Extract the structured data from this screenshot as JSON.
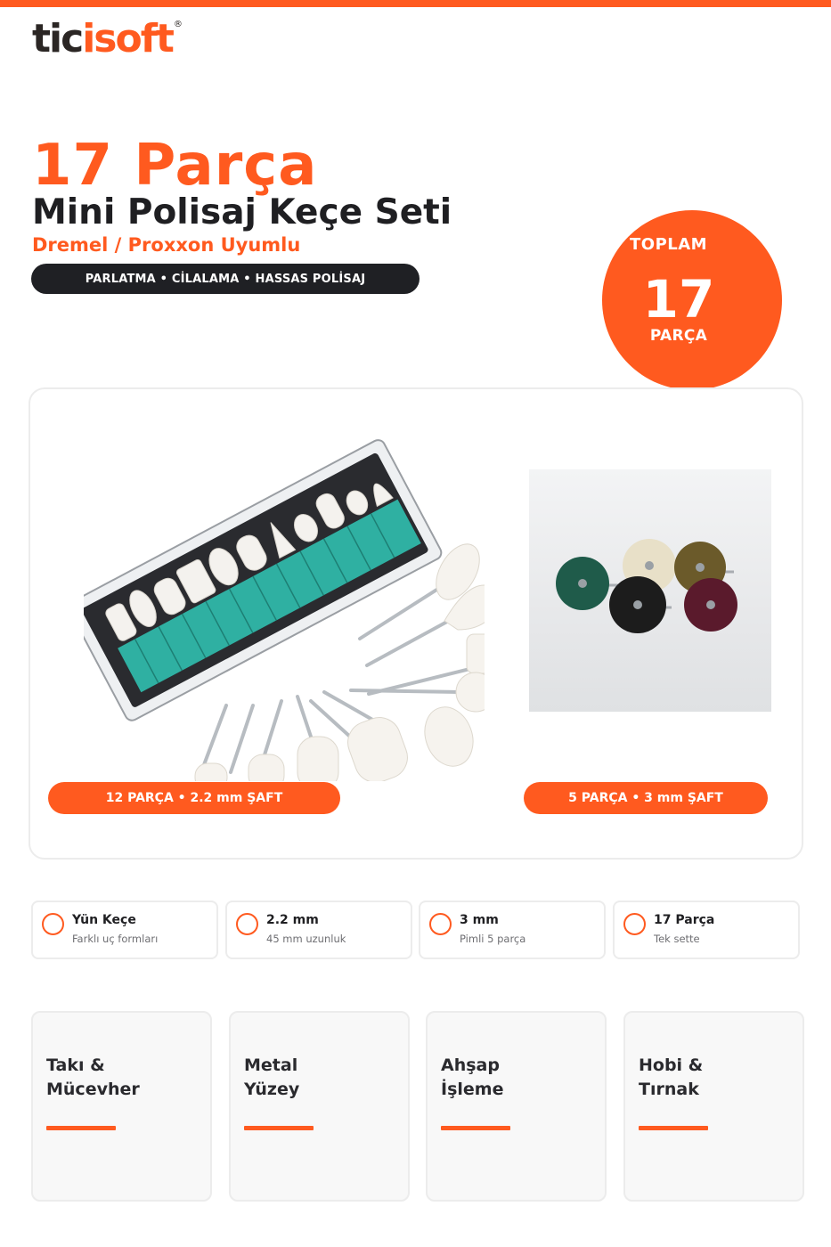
{
  "brand": {
    "logo_dark": "tic",
    "logo_accent": "isoft",
    "registered": "®",
    "accent_color": "#ff5a1f",
    "dark_color": "#1f2024"
  },
  "hero": {
    "count": "17 Parça",
    "title": "Mini Polisaj Keçe Seti",
    "subtitle": "Dremel / Proxxon Uyumlu",
    "tagline": "PARLATMA • CİLALAMA • HASSAS POLİSAJ"
  },
  "total_badge": {
    "top": "TOPLAM",
    "number": "17",
    "bottom": "PARÇA"
  },
  "products": [
    {
      "image": "felt-polishing-bits-set",
      "label": "12 PARÇA • 2.2 mm ŞAFT"
    },
    {
      "image": "abrasive-polishing-wheels",
      "label": "5 PARÇA • 3 mm ŞAFT"
    }
  ],
  "features": [
    {
      "title": "Yün Keçe",
      "sub": "Farklı uç formları"
    },
    {
      "title": "2.2 mm",
      "sub": "45 mm uzunluk"
    },
    {
      "title": "3 mm",
      "sub": "Pimli 5 parça"
    },
    {
      "title": "17 Parça",
      "sub": "Tek sette"
    }
  ],
  "usage": [
    {
      "title": "Takı &\nMücevher"
    },
    {
      "title": "Metal\nYüzey"
    },
    {
      "title": "Ahşap\nİşleme"
    },
    {
      "title": "Hobi &\nTırnak"
    }
  ],
  "wheel_colors": [
    "#1f5b4a",
    "#e8e0c8",
    "#6b5a2a",
    "#1c1c1c",
    "#5a1a2c"
  ]
}
